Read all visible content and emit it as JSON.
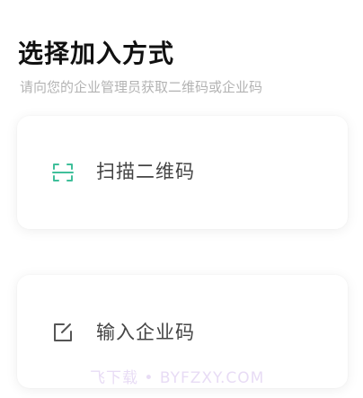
{
  "header": {
    "title": "选择加入方式",
    "subtitle": "请向您的企业管理员获取二维码或企业码"
  },
  "options": [
    {
      "label": "扫描二维码",
      "icon": "scan-icon",
      "icon_color": "#3fbf9a"
    },
    {
      "label": "输入企业码",
      "icon": "edit-icon",
      "icon_color": "#555555"
    }
  ],
  "watermark": "飞下载 • BYFZXY.COM"
}
